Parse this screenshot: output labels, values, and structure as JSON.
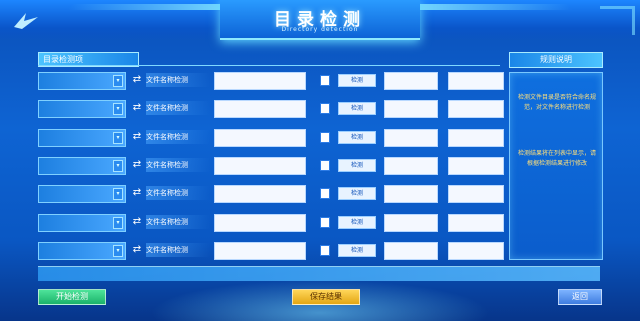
{
  "header": {
    "title": "目录检测",
    "subtitle": "Directory detection"
  },
  "section": {
    "title": "目录检测项"
  },
  "rows": [
    {
      "label": "文件名称检测",
      "button": "检测",
      "arrow": "▾"
    },
    {
      "label": "文件名称检测",
      "button": "检测",
      "arrow": "▾"
    },
    {
      "label": "文件名称检测",
      "button": "检测",
      "arrow": "▾"
    },
    {
      "label": "文件名称检测",
      "button": "检测",
      "arrow": "▾"
    },
    {
      "label": "文件名称检测",
      "button": "检测",
      "arrow": "▾"
    },
    {
      "label": "文件名称检测",
      "button": "检测",
      "arrow": "▾"
    },
    {
      "label": "文件名称检测",
      "button": "检测",
      "arrow": "▾"
    }
  ],
  "side": {
    "title": "规则说明",
    "text1": "检测文件目录是否符合命名规范，对文件名称进行检测",
    "text2": "检测结果将在列表中显示，请根据检测结果进行修改"
  },
  "footer": {
    "left_button": "开始检测",
    "mid_button": "保存结果",
    "right_button": "返回"
  },
  "icons": {
    "row_icon": "arrow-swap-icon",
    "logo": "bird-logo-icon"
  },
  "colors": {
    "accent": "#4cc4ff",
    "start": "#1bb36a",
    "save": "#e3a614"
  }
}
